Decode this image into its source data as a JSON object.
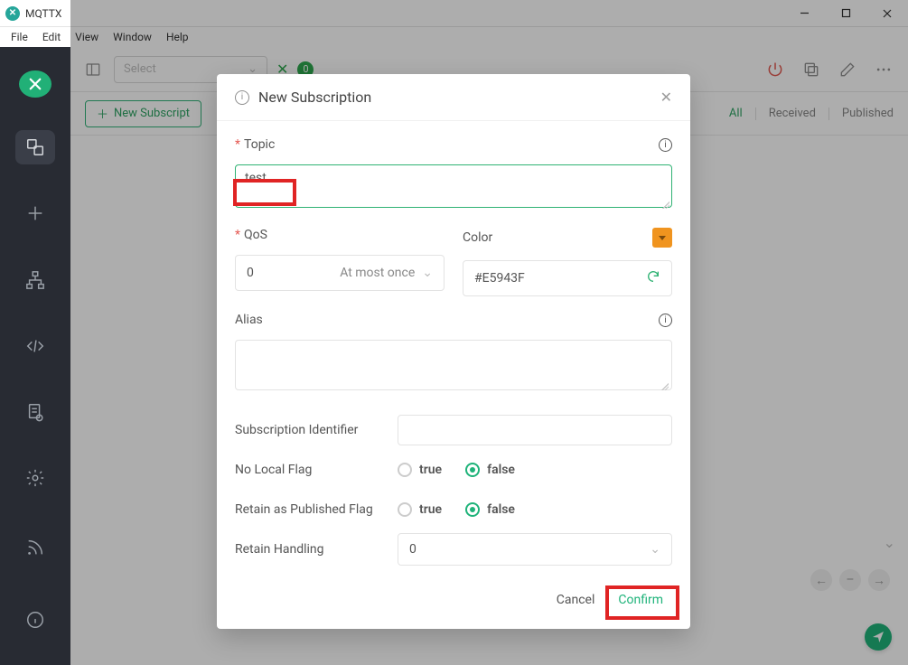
{
  "titlebar": {
    "app_name": "MQTTX",
    "app_icon_letter": "✕"
  },
  "menubar": {
    "items": [
      "File",
      "Edit",
      "View",
      "Window",
      "Help"
    ]
  },
  "toolbar": {
    "select_placeholder": "Select",
    "badge_count": "0"
  },
  "filters": {
    "all": "All",
    "received": "Received",
    "published": "Published"
  },
  "new_sub_button": "New Subscript",
  "dialog": {
    "title": "New Subscription",
    "topic_label": "Topic",
    "topic_value": "test",
    "qos_label": "QoS",
    "qos_value": "0",
    "qos_text": "At most once",
    "color_label": "Color",
    "color_value": "#E5943F",
    "alias_label": "Alias",
    "alias_value": "",
    "sub_id_label": "Subscription Identifier",
    "sub_id_value": "",
    "no_local_label": "No Local Flag",
    "retain_pub_label": "Retain as Published Flag",
    "retain_handling_label": "Retain Handling",
    "retain_handling_value": "0",
    "radio_true": "true",
    "radio_false": "false",
    "cancel": "Cancel",
    "confirm": "Confirm"
  }
}
